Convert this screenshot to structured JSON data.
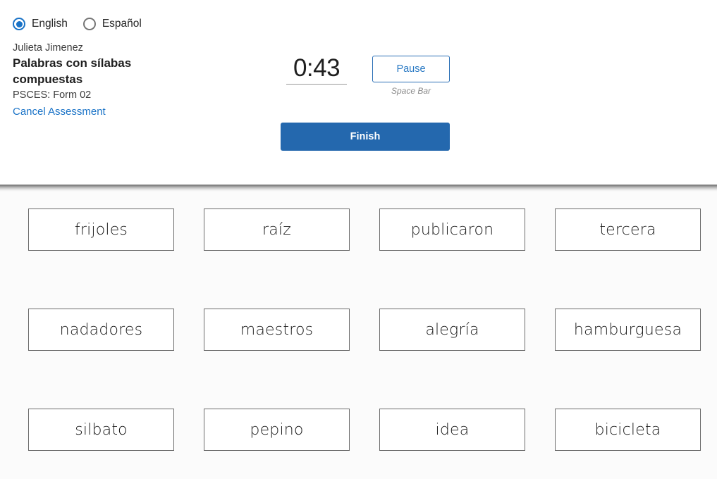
{
  "header": {
    "language_options": [
      {
        "label": "English",
        "selected": true
      },
      {
        "label": "Español",
        "selected": false
      }
    ],
    "student_name": "Julieta Jimenez",
    "assessment_title": "Palabras con sílabas compuestas",
    "form_label": "PSCES: Form 02",
    "cancel_link": "Cancel Assessment",
    "timer": "0:43",
    "pause_label": "Pause",
    "pause_hint": "Space Bar",
    "finish_label": "Finish"
  },
  "colors": {
    "accent_blue": "#1a73c7",
    "button_blue": "#2468ae",
    "link_blue": "#1a73c7",
    "card_border": "#6b6b6b",
    "content_bg": "#fbfbfb",
    "header_bg": "#ffffff"
  },
  "word_grid": {
    "rows": [
      [
        "frijoles",
        "raíz",
        "publicaron",
        "tercera"
      ],
      [
        "nadadores",
        "maestros",
        "alegría",
        "hamburguesa"
      ],
      [
        "silbato",
        "pepino",
        "idea",
        "bicicleta"
      ]
    ]
  }
}
